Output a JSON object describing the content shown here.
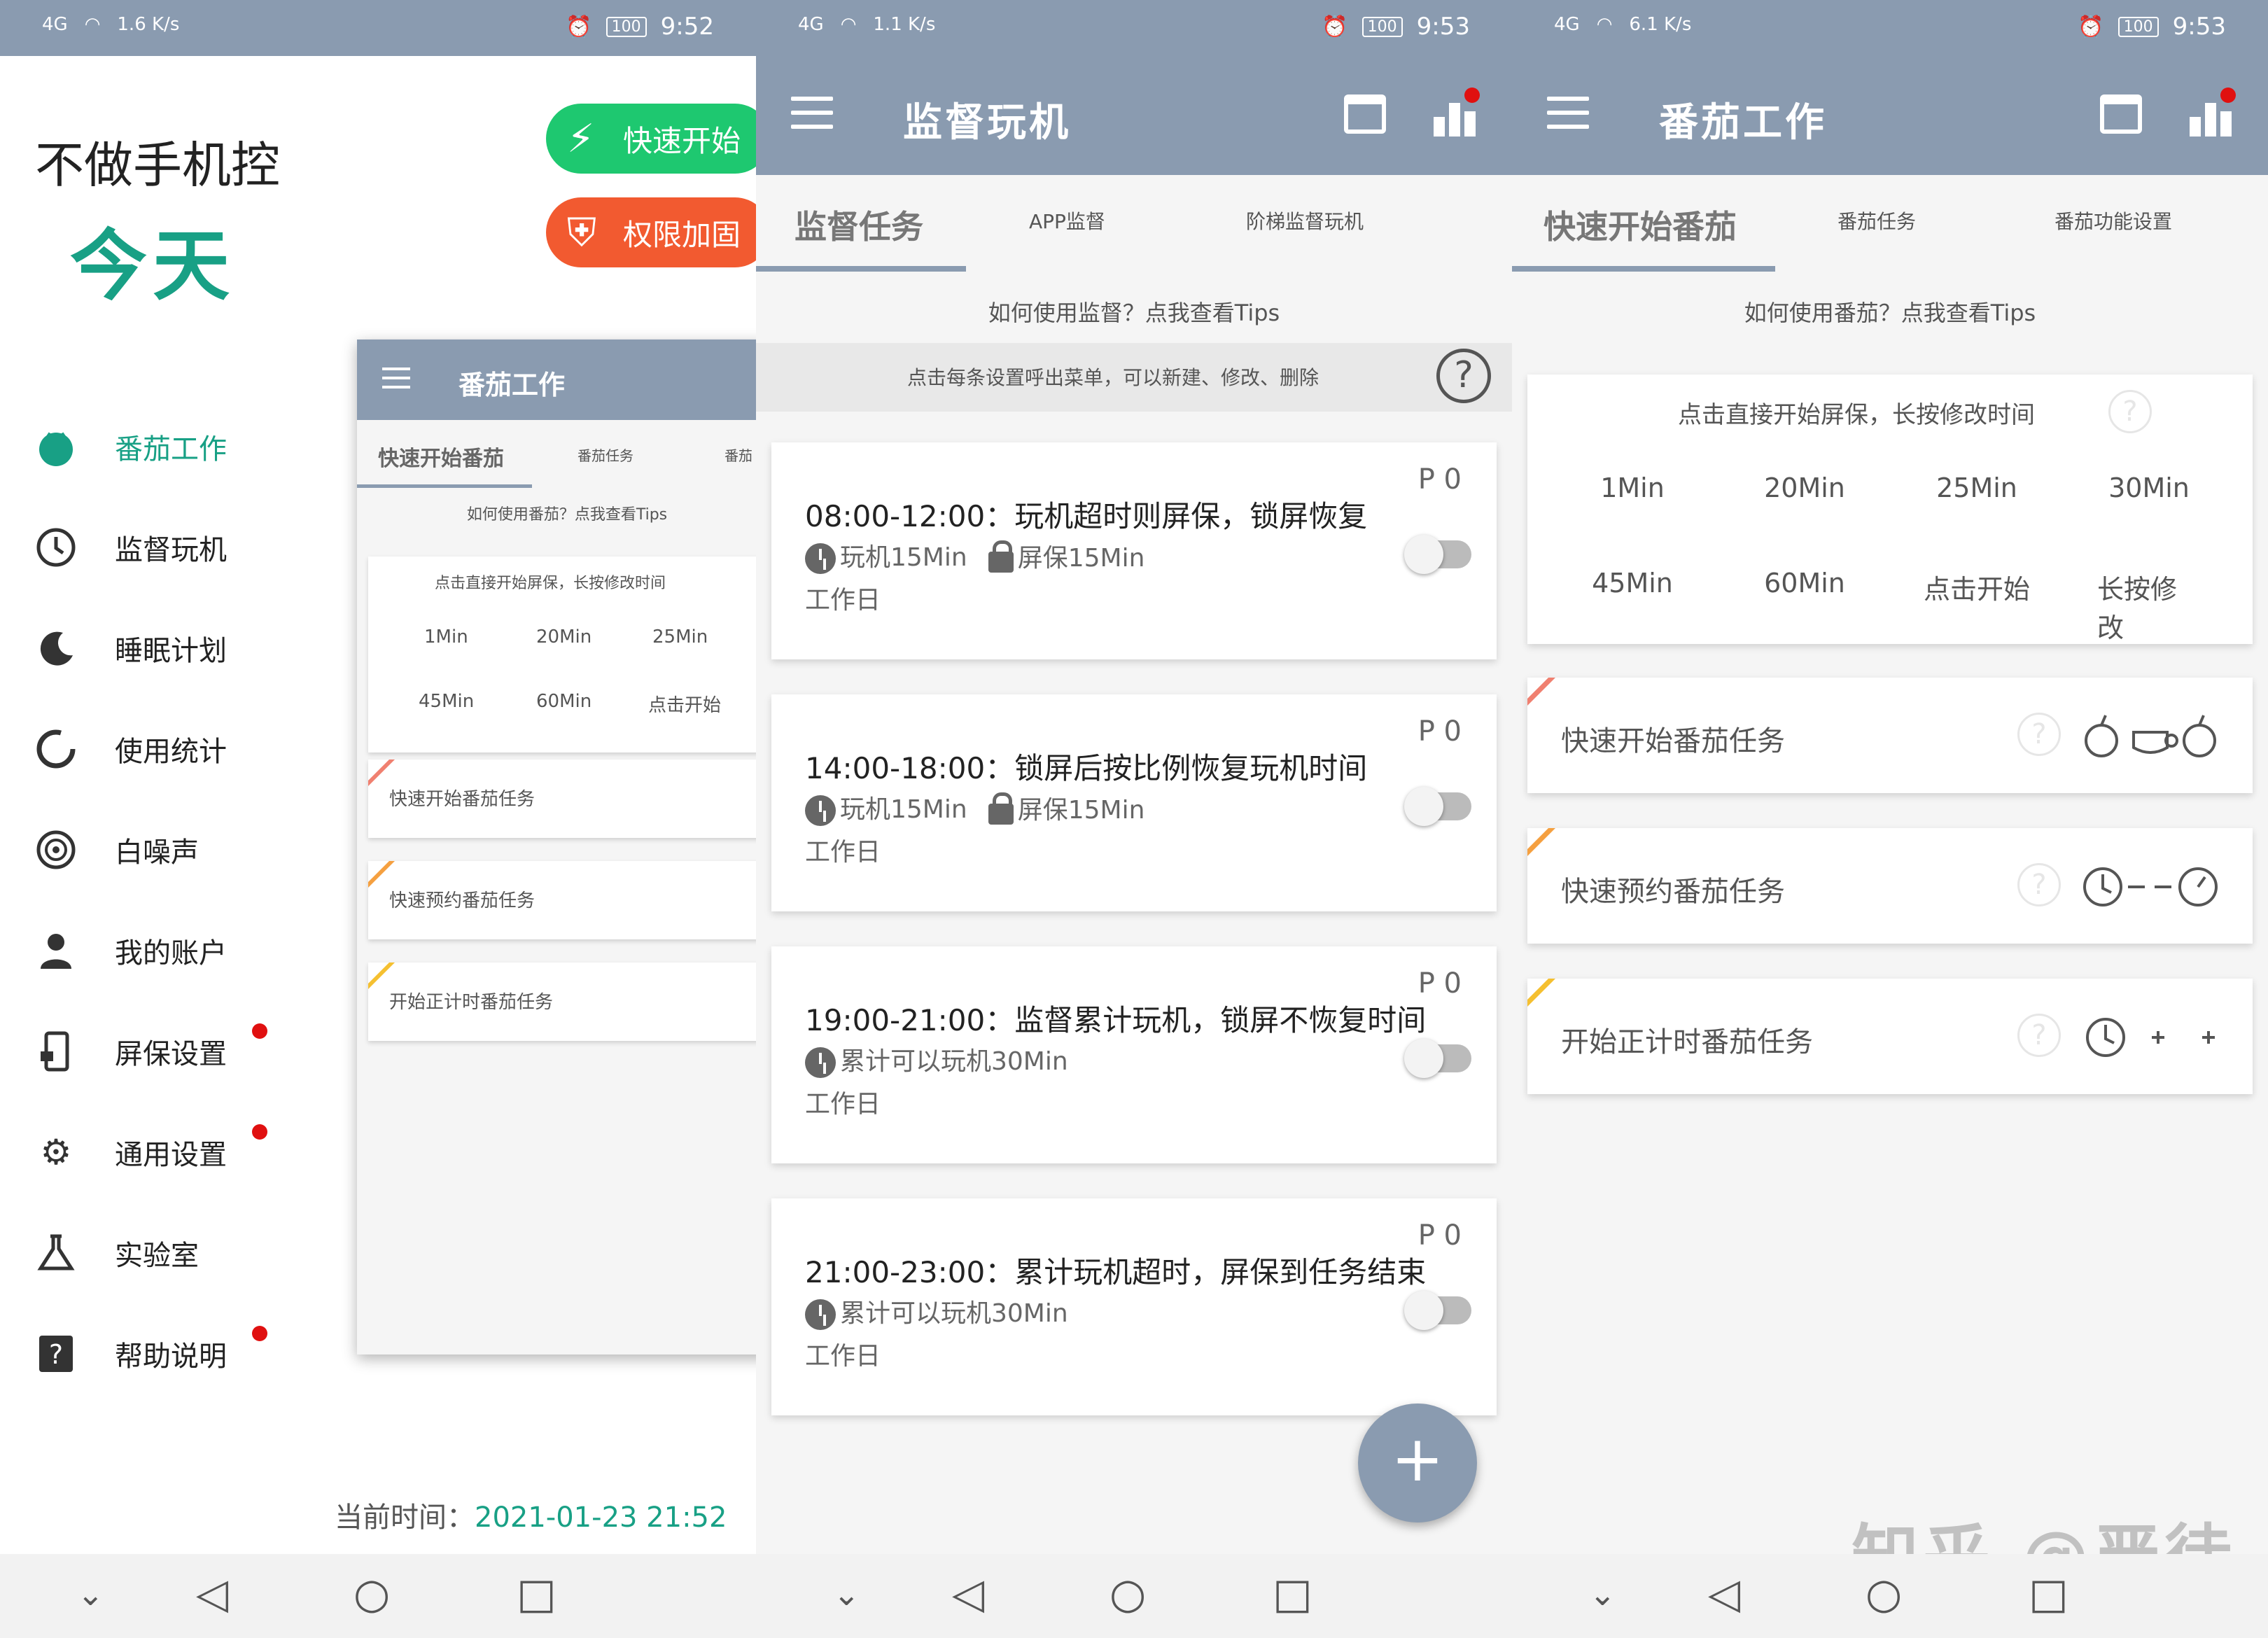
{
  "panel1": {
    "status": {
      "net": "4G",
      "speed": "1.6 K/s",
      "battery": "100",
      "time": "9:52"
    },
    "heading": "不做手机控",
    "subheading": "今天",
    "quick_start": "快速开始",
    "permission": "权限加固",
    "menu": [
      {
        "label": "番茄工作",
        "icon": "tomato-icon",
        "active": true,
        "dot": false
      },
      {
        "label": "监督玩机",
        "icon": "clock-icon",
        "active": false,
        "dot": false
      },
      {
        "label": "睡眠计划",
        "icon": "moon-icon",
        "active": false,
        "dot": false
      },
      {
        "label": "使用统计",
        "icon": "pie-icon",
        "active": false,
        "dot": false
      },
      {
        "label": "白噪声",
        "icon": "speaker-icon",
        "active": false,
        "dot": false
      },
      {
        "label": "我的账户",
        "icon": "person-icon",
        "active": false,
        "dot": false
      },
      {
        "label": "屏保设置",
        "icon": "phone-lock-icon",
        "active": false,
        "dot": true
      },
      {
        "label": "通用设置",
        "icon": "gear-icon",
        "active": false,
        "dot": true
      },
      {
        "label": "实验室",
        "icon": "flask-icon",
        "active": false,
        "dot": false
      },
      {
        "label": "帮助说明",
        "icon": "help-icon",
        "active": false,
        "dot": true
      }
    ],
    "current_time_label": "当前时间：",
    "current_time_value": "2021-01-23  21:52",
    "mini": {
      "title": "番茄工作",
      "tabs": [
        "快速开始番茄",
        "番茄任务",
        "番茄"
      ],
      "tips": "如何使用番茄？点我查看Tips",
      "hint": "点击直接开始屏保，长按修改时间",
      "opts": [
        "1Min",
        "20Min",
        "25Min",
        "45Min",
        "60Min",
        "点击开始"
      ],
      "tasks": [
        "快速开始番茄任务",
        "快速预约番茄任务",
        "开始正计时番茄任务"
      ]
    }
  },
  "panel2": {
    "status": {
      "net": "4G",
      "speed": "1.1 K/s",
      "battery": "100",
      "time": "9:53"
    },
    "title": "监督玩机",
    "tabs": [
      "监督任务",
      "APP监督",
      "阶梯监督玩机"
    ],
    "tips": "如何使用监督？点我查看Tips",
    "hint": "点击每条设置呼出菜单，可以新建、修改、删除",
    "tasks": [
      {
        "time": "08:00-12:00：玩机超时则屏保，锁屏恢复",
        "play": "玩机15Min",
        "lock": "屏保15Min",
        "day": "工作日",
        "p": "P 0"
      },
      {
        "time": "14:00-18:00：锁屏后按比例恢复玩机时间",
        "play": "玩机15Min",
        "lock": "屏保15Min",
        "day": "工作日",
        "p": "P 0"
      },
      {
        "time": "19:00-21:00：监督累计玩机，锁屏不恢复时间",
        "play": "累计可以玩机30Min",
        "lock": "",
        "day": "工作日",
        "p": "P 0"
      },
      {
        "time": "21:00-23:00：累计玩机超时，屏保到任务结束",
        "play": "累计可以玩机30Min",
        "lock": "",
        "day": "工作日",
        "p": "P 0"
      }
    ],
    "fab": "+"
  },
  "panel3": {
    "status": {
      "net": "4G",
      "speed": "6.1 K/s",
      "battery": "100",
      "time": "9:53"
    },
    "title": "番茄工作",
    "tabs": [
      "快速开始番茄",
      "番茄任务",
      "番茄功能设置"
    ],
    "tips": "如何使用番茄？点我查看Tips",
    "hint": "点击直接开始屏保，长按修改时间",
    "opts": [
      "1Min",
      "20Min",
      "25Min",
      "30Min",
      "45Min",
      "60Min",
      "点击开始",
      "长按修改"
    ],
    "tasks": [
      {
        "label": "快速开始番茄任务",
        "flag": "#f08070"
      },
      {
        "label": "快速预约番茄任务",
        "flag": "#f5a040"
      },
      {
        "label": "开始正计时番茄任务",
        "flag": "#f5c030"
      }
    ],
    "watermark": "知乎 @严徒"
  },
  "colors": {
    "accent": "#8a9bb0",
    "green": "#18a085",
    "red": "#e01010",
    "orange": "#f25a30",
    "pillgreen": "#1ec870"
  }
}
